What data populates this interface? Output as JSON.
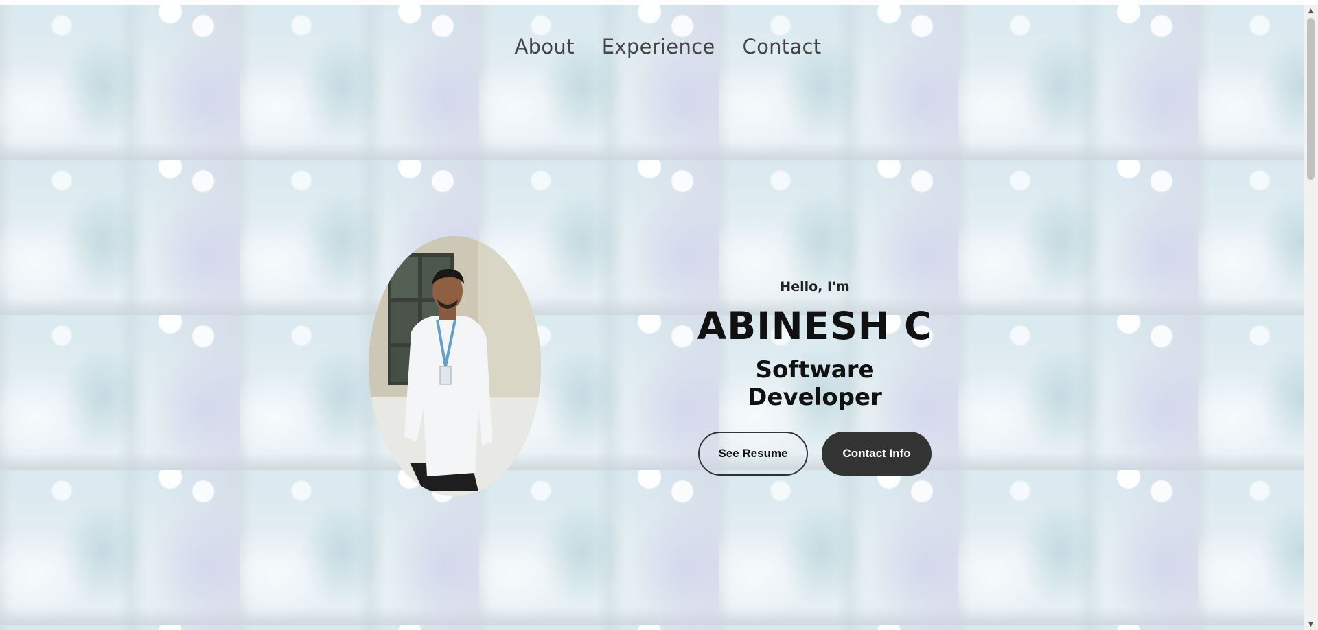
{
  "nav": {
    "items": [
      {
        "label": "About"
      },
      {
        "label": "Experience"
      },
      {
        "label": "Contact"
      }
    ]
  },
  "profile": {
    "image_alt": "Profile picture"
  },
  "hero": {
    "greeting": "Hello, I'm",
    "name": "ABINESH C",
    "title": "Software Developer",
    "resume_button": "See Resume",
    "contact_button": "Contact Info"
  },
  "colors": {
    "text_dark": "#111111",
    "nav_text": "#444444",
    "button_dark": "#333333",
    "button_text_light": "#ffffff"
  },
  "icons": {
    "scroll_up": "triangle-up-icon",
    "scroll_down": "triangle-down-icon"
  }
}
